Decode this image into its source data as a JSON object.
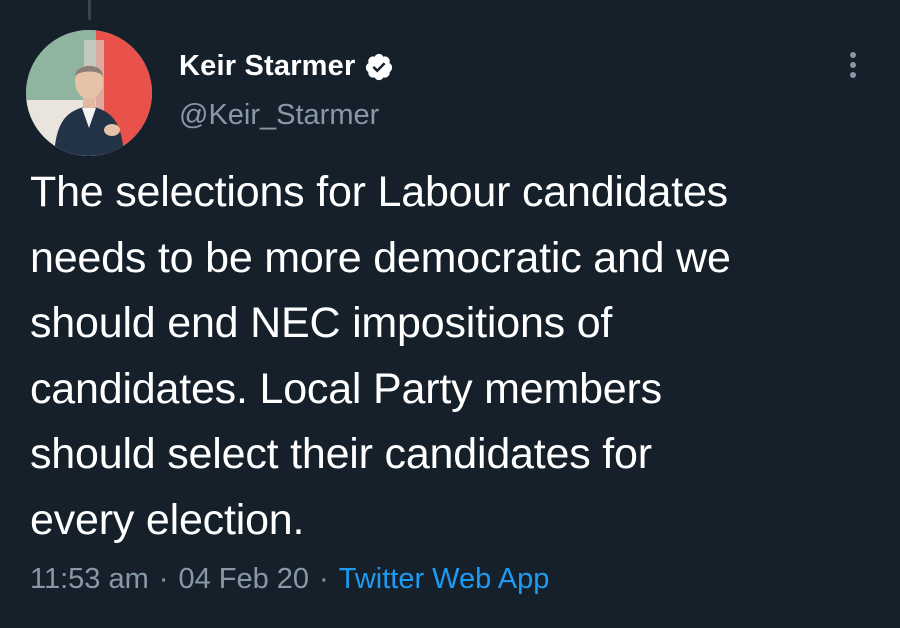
{
  "tweet": {
    "author": {
      "display_name": "Keir Starmer",
      "handle": "@Keir_Starmer",
      "verified": true,
      "avatar_icon": "avatar-photo"
    },
    "text": "The selections for Labour candidates\nneeds to be more democratic and we\nshould end NEC impositions of\ncandidates. Local Party members\nshould select their candidates for\nevery election.",
    "time": "11:53 am",
    "date": "04 Feb 20",
    "separator": "·",
    "source": "Twitter Web App"
  },
  "icons": {
    "verified": "verified-badge-icon",
    "more": "more-options-icon"
  },
  "colors": {
    "background": "#15202b",
    "text": "#ffffff",
    "secondary_text": "#8899a6",
    "link": "#1d9bf0"
  }
}
